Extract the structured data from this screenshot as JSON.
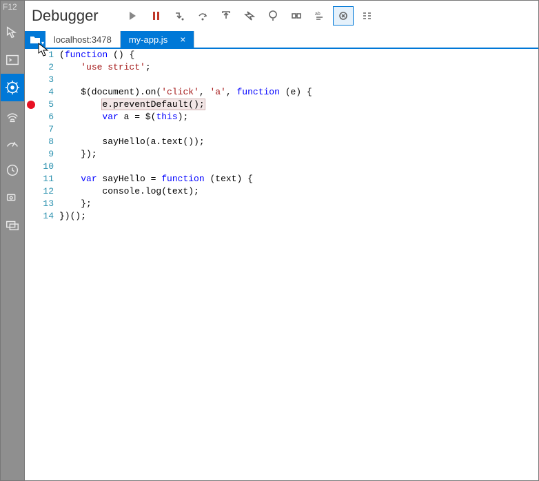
{
  "window_label": "F12",
  "title": "Debugger",
  "sidebar": {
    "items": [
      {
        "name": "pointer",
        "active": false
      },
      {
        "name": "console",
        "active": false
      },
      {
        "name": "debugger",
        "active": true
      },
      {
        "name": "network",
        "active": false
      },
      {
        "name": "performance",
        "active": false
      },
      {
        "name": "memory",
        "active": false
      },
      {
        "name": "emulation",
        "active": false
      },
      {
        "name": "screenshot-list",
        "active": false
      }
    ]
  },
  "toolbar": {
    "play": "play",
    "pause": "pause",
    "step_into": "step-into",
    "step_over": "step-over",
    "step_out": "step-out",
    "break_all": "break-all",
    "exceptions": "exceptions",
    "toggle_bp": "toggle-breakpoints",
    "pretty": "pretty-print",
    "word_wrap": "word-wrap",
    "just_my_code": "just-my-code"
  },
  "tabs": [
    {
      "label": "localhost:3478",
      "active": false,
      "closable": false
    },
    {
      "label": "my-app.js",
      "active": true,
      "closable": true
    }
  ],
  "breakpoints": [
    5
  ],
  "hovered_line": 5,
  "hovered_text": "e.preventDefault();",
  "code": {
    "lines": [
      {
        "n": 1,
        "segs": [
          [
            "(",
            ""
          ],
          [
            "function",
            "kw"
          ],
          [
            " () {",
            ""
          ]
        ]
      },
      {
        "n": 2,
        "segs": [
          [
            "    ",
            ""
          ],
          [
            "'use strict'",
            "str"
          ],
          [
            ";",
            ""
          ]
        ]
      },
      {
        "n": 3,
        "segs": [
          [
            "",
            ""
          ]
        ]
      },
      {
        "n": 4,
        "segs": [
          [
            "    $(document).on(",
            ""
          ],
          [
            "'click'",
            "str"
          ],
          [
            ", ",
            ""
          ],
          [
            "'a'",
            "str"
          ],
          [
            ", ",
            ""
          ],
          [
            "function",
            "kw"
          ],
          [
            " (e) {",
            ""
          ]
        ]
      },
      {
        "n": 5,
        "segs": [
          [
            "        ",
            ""
          ],
          [
            "e.preventDefault();",
            "hl"
          ]
        ]
      },
      {
        "n": 6,
        "segs": [
          [
            "        ",
            ""
          ],
          [
            "var",
            "kw"
          ],
          [
            " a = $(",
            ""
          ],
          [
            "this",
            "kw"
          ],
          [
            ");",
            ""
          ]
        ]
      },
      {
        "n": 7,
        "segs": [
          [
            "",
            ""
          ]
        ]
      },
      {
        "n": 8,
        "segs": [
          [
            "        sayHello(a.text());",
            ""
          ]
        ]
      },
      {
        "n": 9,
        "segs": [
          [
            "    });",
            ""
          ]
        ]
      },
      {
        "n": 10,
        "segs": [
          [
            "",
            ""
          ]
        ]
      },
      {
        "n": 11,
        "segs": [
          [
            "    ",
            ""
          ],
          [
            "var",
            "kw"
          ],
          [
            " sayHello = ",
            ""
          ],
          [
            "function",
            "kw"
          ],
          [
            " (text) {",
            ""
          ]
        ]
      },
      {
        "n": 12,
        "segs": [
          [
            "        console.log(text);",
            ""
          ]
        ]
      },
      {
        "n": 13,
        "segs": [
          [
            "    };",
            ""
          ]
        ]
      },
      {
        "n": 14,
        "segs": [
          [
            "})();",
            ""
          ]
        ]
      }
    ]
  }
}
